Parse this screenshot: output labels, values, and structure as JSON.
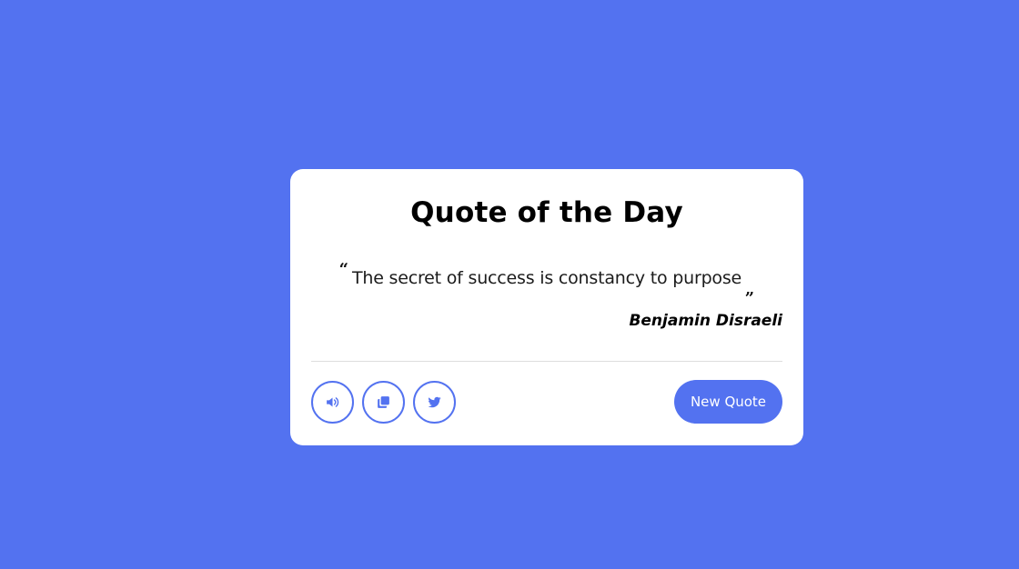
{
  "card": {
    "title": "Quote of the Day",
    "quote": {
      "open_mark": "“",
      "text": "The secret of success is constancy to purpose",
      "close_mark": "„"
    },
    "author": "Benjamin Disraeli",
    "actions": {
      "buttons": [
        {
          "icon": "speaker-icon"
        },
        {
          "icon": "copy-icon"
        },
        {
          "icon": "twitter-icon"
        }
      ],
      "new_quote_label": "New Quote"
    }
  },
  "colors": {
    "background": "#5372f0",
    "accent": "#5372f0",
    "card": "#ffffff"
  }
}
